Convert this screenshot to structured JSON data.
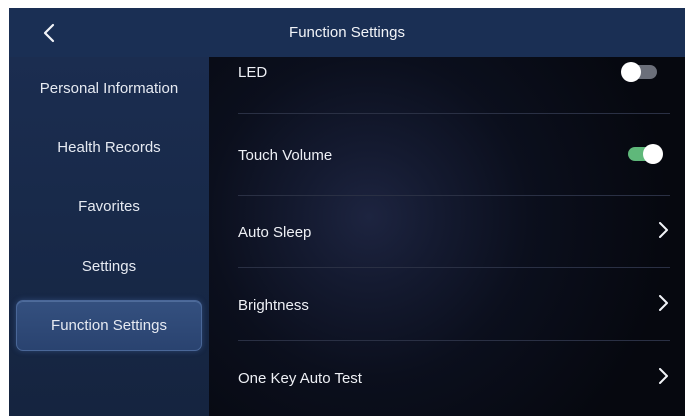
{
  "header": {
    "title": "Function Settings",
    "back_icon": "chevron-left-icon"
  },
  "sidebar": {
    "items": [
      {
        "label": "Personal Information",
        "active": false
      },
      {
        "label": "Health Records",
        "active": false
      },
      {
        "label": "Favorites",
        "active": false
      },
      {
        "label": "Settings",
        "active": false
      },
      {
        "label": "Function Settings",
        "active": true
      }
    ]
  },
  "settings": {
    "led": {
      "label": "LED",
      "enabled": false
    },
    "touch_volume": {
      "label": "Touch Volume",
      "enabled": true
    },
    "auto_sleep": {
      "label": "Auto Sleep",
      "icon": "chevron-right-icon"
    },
    "brightness": {
      "label": "Brightness",
      "icon": "chevron-right-icon"
    },
    "one_key_auto_test": {
      "label": "One Key Auto Test",
      "icon": "chevron-right-icon"
    }
  },
  "colors": {
    "header_bg": "#1a2f54",
    "sidebar_bg": "#172847",
    "active_item_bg": "#2f4a78",
    "toggle_on": "#5fb87a",
    "toggle_off": "#6b6f7a",
    "content_bg": "#06080f"
  }
}
